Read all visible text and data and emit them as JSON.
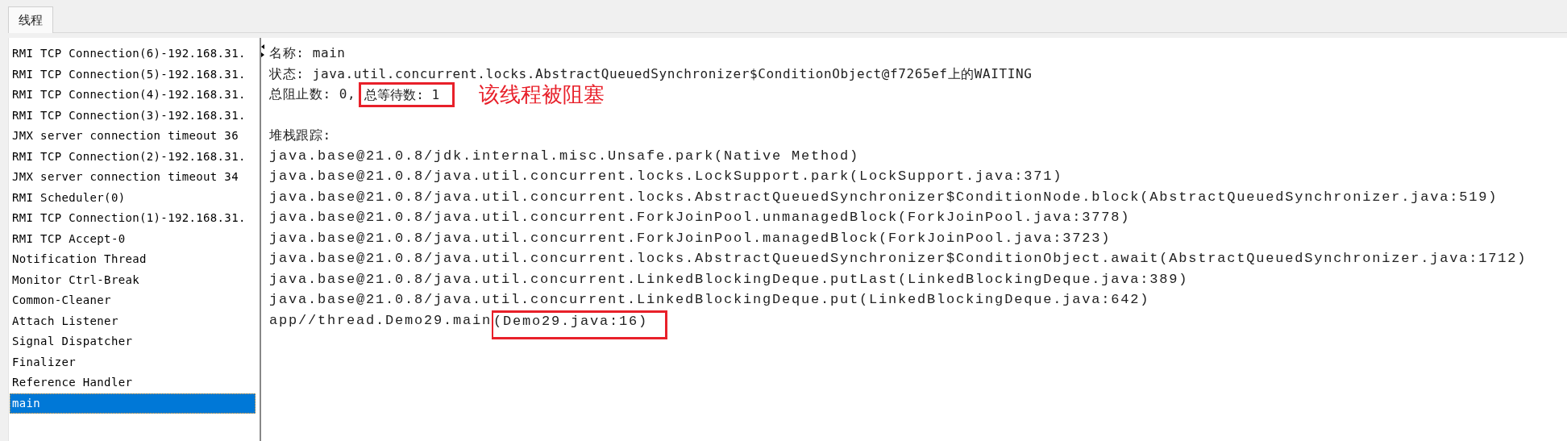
{
  "tabs": [
    {
      "label": "线程",
      "selected": true
    }
  ],
  "threads": [
    {
      "name": "RMI TCP Connection(6)-192.168.31.",
      "selected": false
    },
    {
      "name": "RMI TCP Connection(5)-192.168.31.",
      "selected": false
    },
    {
      "name": "RMI TCP Connection(4)-192.168.31.",
      "selected": false
    },
    {
      "name": "RMI TCP Connection(3)-192.168.31.",
      "selected": false
    },
    {
      "name": "JMX server connection timeout 36",
      "selected": false
    },
    {
      "name": "RMI TCP Connection(2)-192.168.31.",
      "selected": false
    },
    {
      "name": "JMX server connection timeout 34",
      "selected": false
    },
    {
      "name": "RMI Scheduler(0)",
      "selected": false
    },
    {
      "name": "RMI TCP Connection(1)-192.168.31.",
      "selected": false
    },
    {
      "name": "RMI TCP Accept-0",
      "selected": false
    },
    {
      "name": "Notification Thread",
      "selected": false
    },
    {
      "name": "Monitor Ctrl-Break",
      "selected": false
    },
    {
      "name": "Common-Cleaner",
      "selected": false
    },
    {
      "name": "Attach Listener",
      "selected": false
    },
    {
      "name": "Signal Dispatcher",
      "selected": false
    },
    {
      "name": "Finalizer",
      "selected": false
    },
    {
      "name": "Reference Handler",
      "selected": false
    },
    {
      "name": "main",
      "selected": true
    }
  ],
  "details": {
    "name_line": "名称: main",
    "state_line": "状态: java.util.concurrent.locks.AbstractQueuedSynchronizer$ConditionObject@f7265ef上的WAITING",
    "blocked_count": "总阻止数: 0,",
    "waited_count": "总等待数: 1",
    "annotation": "该线程被阻塞",
    "stack_heading": "堆栈跟踪:",
    "stack_trace": [
      {
        "text": "java.base@21.0.8/jdk.internal.misc.Unsafe.park(Native Method)"
      },
      {
        "text": "java.base@21.0.8/java.util.concurrent.locks.LockSupport.park(LockSupport.java:371)"
      },
      {
        "text": "java.base@21.0.8/java.util.concurrent.locks.AbstractQueuedSynchronizer$ConditionNode.block(AbstractQueuedSynchronizer.java:519)"
      },
      {
        "text": "java.base@21.0.8/java.util.concurrent.ForkJoinPool.unmanagedBlock(ForkJoinPool.java:3778)"
      },
      {
        "text": "java.base@21.0.8/java.util.concurrent.ForkJoinPool.managedBlock(ForkJoinPool.java:3723)"
      },
      {
        "text": "java.base@21.0.8/java.util.concurrent.locks.AbstractQueuedSynchronizer$ConditionObject.await(AbstractQueuedSynchronizer.java:1712)"
      },
      {
        "text": "java.base@21.0.8/java.util.concurrent.LinkedBlockingDeque.putLast(LinkedBlockingDeque.java:389)"
      },
      {
        "text": "java.base@21.0.8/java.util.concurrent.LinkedBlockingDeque.put(LinkedBlockingDeque.java:642)"
      },
      {
        "text": "app//thread.Demo29.main",
        "highlighted": "(Demo29.java:16)"
      }
    ]
  }
}
